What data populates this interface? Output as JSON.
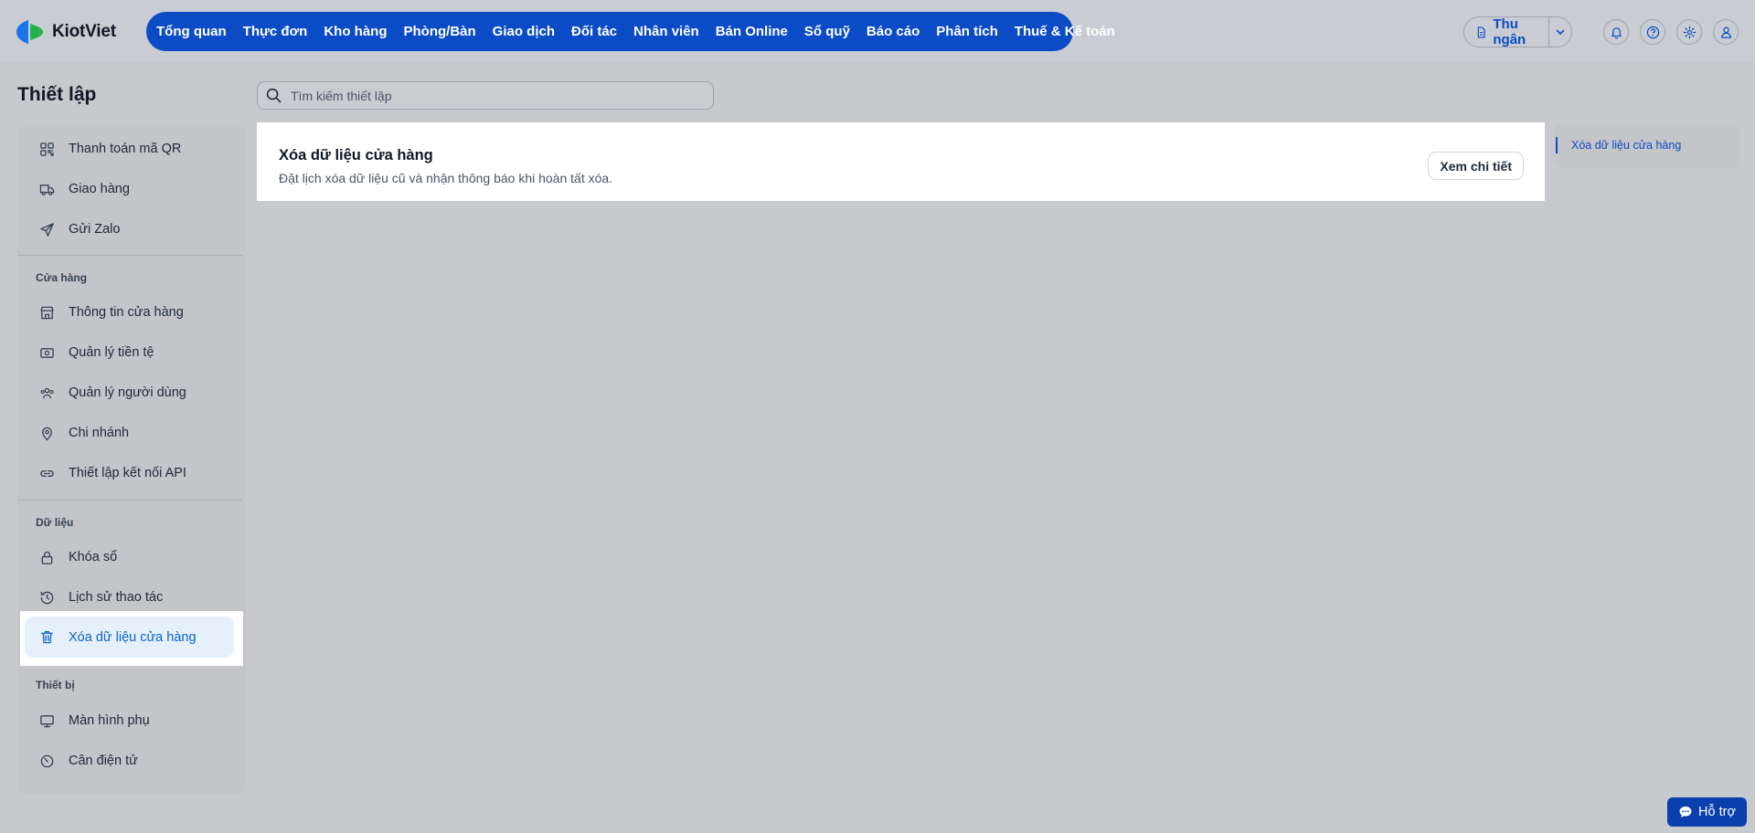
{
  "app": {
    "name": "KiotViet"
  },
  "header": {
    "nav": [
      "Tổng quan",
      "Thực đơn",
      "Kho hàng",
      "Phòng/Bàn",
      "Giao dịch",
      "Đối tác",
      "Nhân viên",
      "Bán Online",
      "Sổ quỹ",
      "Báo cáo",
      "Phân tích",
      "Thuế & Kế toán"
    ],
    "cashier_label": "Thu ngân",
    "icons": [
      "bell-icon",
      "help-circle-icon",
      "settings-icon",
      "user-icon"
    ]
  },
  "page": {
    "title": "Thiết lập",
    "search_placeholder": "Tìm kiếm thiết lập"
  },
  "sidebar": {
    "top_items": [
      {
        "label": "Thanh toán mã QR",
        "icon": "qr-code-icon"
      },
      {
        "label": "Giao hàng",
        "icon": "truck-icon"
      },
      {
        "label": "Gửi Zalo",
        "icon": "send-icon"
      }
    ],
    "sections": [
      {
        "title": "Cửa hàng",
        "items": [
          {
            "label": "Thông tin cửa hàng",
            "icon": "store-icon"
          },
          {
            "label": "Quản lý tiền tệ",
            "icon": "currency-icon"
          },
          {
            "label": "Quản lý người dùng",
            "icon": "users-icon"
          },
          {
            "label": "Chi nhánh",
            "icon": "map-pin-icon"
          },
          {
            "label": "Thiết lập kết nối API",
            "icon": "link-icon"
          }
        ]
      },
      {
        "title": "Dữ liệu",
        "items": [
          {
            "label": "Khóa sổ",
            "icon": "lock-icon"
          },
          {
            "label": "Lịch sử thao tác",
            "icon": "history-icon"
          },
          {
            "label": "Xóa dữ liệu cửa hàng",
            "icon": "trash-icon",
            "active": true
          }
        ]
      },
      {
        "title": "Thiết bị",
        "items": [
          {
            "label": "Màn hình phụ",
            "icon": "monitor-icon"
          },
          {
            "label": "Cân điện tử",
            "icon": "scale-icon"
          }
        ]
      }
    ]
  },
  "card": {
    "title": "Xóa dữ liệu cửa hàng",
    "description": "Đặt lịch xóa dữ liệu cũ và nhận thông báo khi hoàn tất xóa.",
    "button": "Xem chi tiết"
  },
  "anchor_nav": {
    "items": [
      "Xóa dữ liệu cửa hàng"
    ]
  },
  "help": {
    "label": "Hỗ trợ"
  },
  "colors": {
    "brand": "#0b4cc6",
    "active_bg": "#e5f0fb",
    "active_text": "#0b63ce"
  }
}
